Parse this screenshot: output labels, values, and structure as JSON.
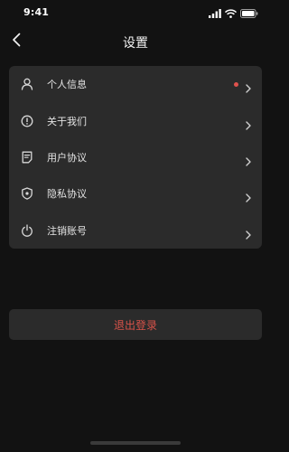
{
  "status_bar": {
    "time": "9:41",
    "icons": [
      "signal-icon",
      "wifi-icon",
      "battery-icon"
    ]
  },
  "nav": {
    "back_icon": "chevron-left-icon",
    "title": "设置"
  },
  "menu": {
    "items": [
      {
        "label": "个人信息",
        "icon": "user-icon",
        "badge": true
      },
      {
        "label": "关于我们",
        "icon": "info-icon",
        "badge": false
      },
      {
        "label": "用户协议",
        "icon": "document-icon",
        "badge": false
      },
      {
        "label": "隐私协议",
        "icon": "shield-icon",
        "badge": false
      },
      {
        "label": "注销账号",
        "icon": "power-icon",
        "badge": false
      }
    ]
  },
  "logout": {
    "label": "退出登录"
  },
  "colors": {
    "background": "#121212",
    "card": "#2b2b2b",
    "accent_red": "#e0524d",
    "text": "#e4e4e4"
  }
}
